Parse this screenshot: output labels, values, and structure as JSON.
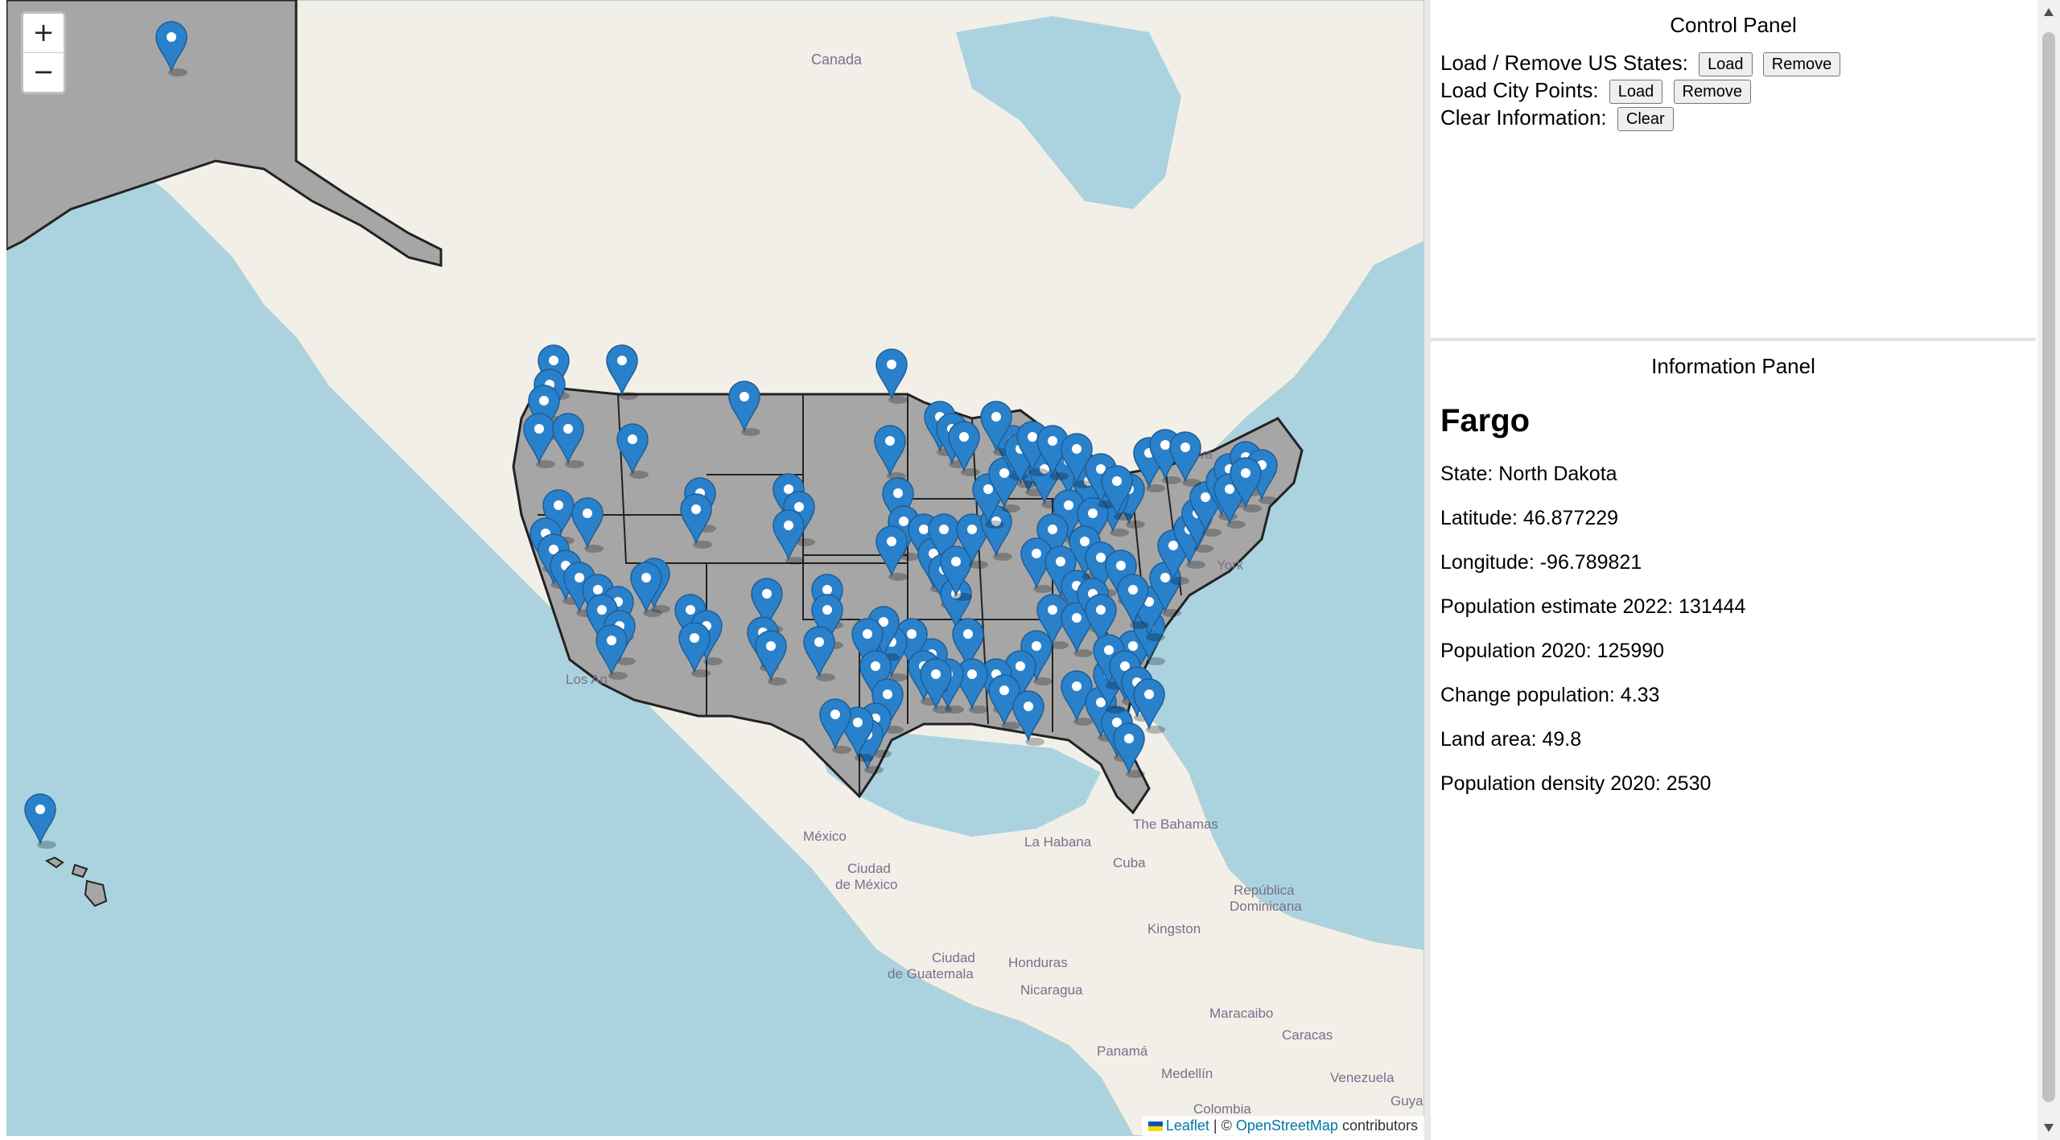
{
  "map": {
    "zoom_in_label": "+",
    "zoom_out_label": "−",
    "attribution": {
      "leaflet": "Leaflet",
      "separator": "| ©",
      "osm": "OpenStreetMap",
      "suffix": "contributors"
    },
    "place_labels": [
      "Canada",
      "Ottawa",
      "Tor",
      "York",
      "Los An",
      "México",
      "Ciudad",
      "de México",
      "La Habana",
      "Cuba",
      "The Bahamas",
      "República",
      "Dominicana",
      "Kingston",
      "Ciudad",
      "de Guatemala",
      "Honduras",
      "Nicaragua",
      "Maracaibo",
      "Caracas",
      "Panamá",
      "Medellín",
      "Venezuela",
      "Colombia",
      "Guya"
    ],
    "colors": {
      "water": "#aad3df",
      "land": "#f2efe9",
      "state_fill": "#a6a6a6",
      "state_stroke": "#222222",
      "marker": "#2a81cb"
    },
    "icons": [
      "map-marker-icon"
    ]
  },
  "control_panel": {
    "title": "Control Panel",
    "rows": [
      {
        "label": "Load / Remove US States:",
        "buttons": [
          "Load",
          "Remove"
        ]
      },
      {
        "label": "Load City Points:",
        "buttons": [
          "Load",
          "Remove"
        ]
      },
      {
        "label": "Clear Information:",
        "buttons": [
          "Clear"
        ]
      }
    ]
  },
  "info_panel": {
    "title": "Information Panel",
    "city": "Fargo",
    "lines": [
      "State: North Dakota",
      "Latitude: 46.877229",
      "Longitude: -96.789821",
      "Population estimate 2022: 131444",
      "Population 2020: 125990",
      "Change population: 4.33",
      "Land area: 49.8",
      "Population density 2020: 2530"
    ]
  }
}
